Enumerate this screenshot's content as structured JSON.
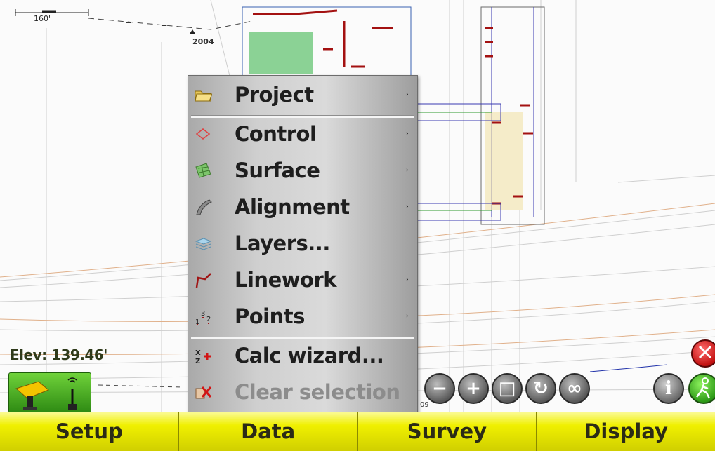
{
  "map": {
    "scale_label": "160'",
    "point_label": "2004",
    "point_label_2": "09",
    "elevation": "Elev: 139.46'"
  },
  "menu": {
    "items": [
      {
        "label": "Project",
        "submenu": true,
        "icon": "folder-icon",
        "enabled": true
      },
      {
        "label": "Control",
        "submenu": true,
        "icon": "control-icon",
        "enabled": true
      },
      {
        "label": "Surface",
        "submenu": true,
        "icon": "surface-icon",
        "enabled": true
      },
      {
        "label": "Alignment",
        "submenu": true,
        "icon": "alignment-icon",
        "enabled": true
      },
      {
        "label": "Layers...",
        "submenu": false,
        "icon": "layers-icon",
        "enabled": true
      },
      {
        "label": "Linework",
        "submenu": true,
        "icon": "linework-icon",
        "enabled": true
      },
      {
        "label": "Points",
        "submenu": true,
        "icon": "points-icon",
        "enabled": true
      },
      {
        "label": "Calc wizard...",
        "submenu": false,
        "icon": "calc-wizard-icon",
        "enabled": true
      },
      {
        "label": "Clear selection",
        "submenu": false,
        "icon": "clear-selection-icon",
        "enabled": false
      }
    ],
    "submenu_arrow": "›"
  },
  "tabs": [
    "Setup",
    "Data",
    "Survey",
    "Display"
  ],
  "map_buttons": {
    "zoom_out": "−",
    "zoom_in": "+",
    "zoom_extents": "□",
    "rotate": "↻",
    "infinity": "∞",
    "info": "i"
  },
  "colors": {
    "tab_yellow": "#f0f000",
    "gps_green": "#4fb226",
    "stop_red": "#c21010"
  }
}
